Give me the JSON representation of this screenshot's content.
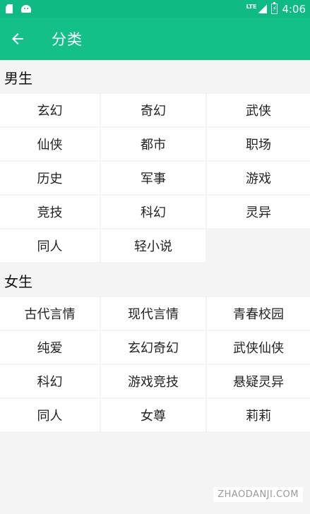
{
  "status_bar": {
    "time": "4:06",
    "network": "LTE",
    "battery_icon": "battery-charging-icon",
    "accent": "#0fba83"
  },
  "app_bar": {
    "title": "分类",
    "back_icon": "arrow-back-icon",
    "color": "#13c08a"
  },
  "sections": [
    {
      "title": "男生",
      "items": [
        "玄幻",
        "奇幻",
        "武侠",
        "仙侠",
        "都市",
        "职场",
        "历史",
        "军事",
        "游戏",
        "竞技",
        "科幻",
        "灵异",
        "同人",
        "轻小说"
      ]
    },
    {
      "title": "女生",
      "items": [
        "古代言情",
        "现代言情",
        "青春校园",
        "纯爱",
        "玄幻奇幻",
        "武侠仙侠",
        "科幻",
        "游戏竞技",
        "悬疑灵异",
        "同人",
        "女尊",
        "莉莉"
      ]
    }
  ],
  "watermark": "ZHAODANJI.COM"
}
